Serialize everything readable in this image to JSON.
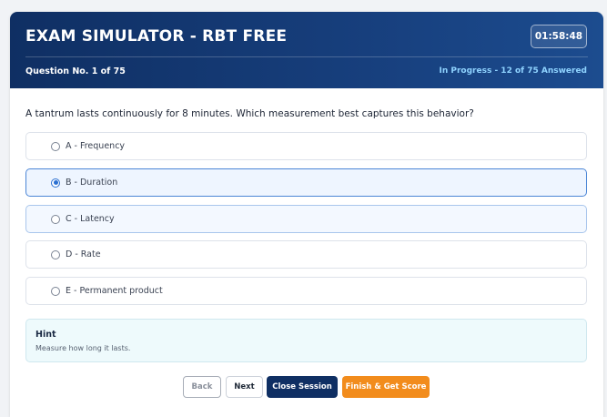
{
  "header": {
    "title": "EXAM SIMULATOR - RBT FREE",
    "timer": "01:58:48",
    "question_no": "Question No. 1 of 75",
    "status": "In Progress - 12 of 75 Answered"
  },
  "question": {
    "text": "A tantrum lasts continuously for 8 minutes. Which measurement best captures this behavior?",
    "options": [
      {
        "label": "A - Frequency",
        "selected": false
      },
      {
        "label": "B - Duration",
        "selected": true
      },
      {
        "label": "C - Latency",
        "selected": false
      },
      {
        "label": "D - Rate",
        "selected": false
      },
      {
        "label": "E - Permanent product",
        "selected": false
      }
    ]
  },
  "hint": {
    "title": "Hint",
    "text": "Measure how long it lasts."
  },
  "buttons": {
    "back": "Back",
    "next": "Next",
    "close": "Close Session",
    "finish": "Finish & Get Score"
  },
  "colors": {
    "header_bg": "#0f2f63",
    "status_text": "#8fd3ff",
    "selected_border": "#4c86d6",
    "finish_button": "#f28c1c",
    "close_button": "#0f2f63"
  }
}
